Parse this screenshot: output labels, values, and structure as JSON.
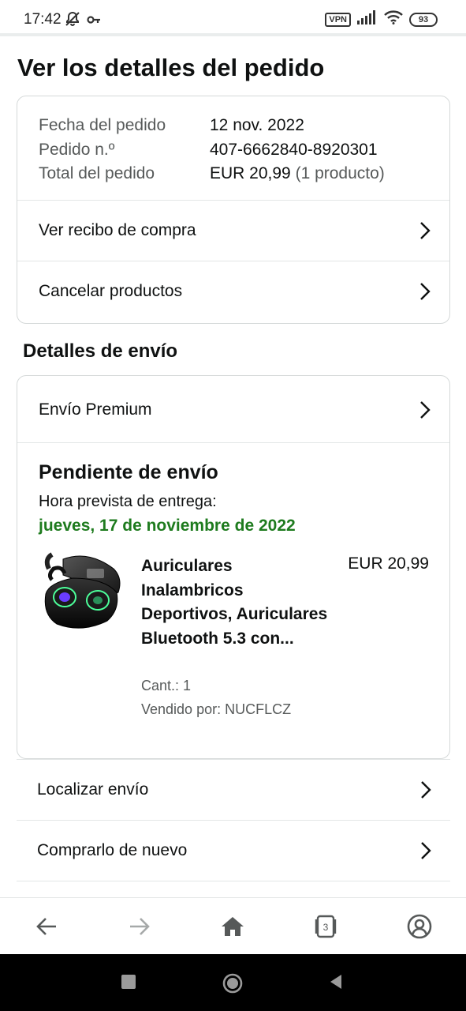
{
  "status_bar": {
    "time": "17:42",
    "vpn": "VPN",
    "battery": "93",
    "icons": [
      "bell-off-icon",
      "key-icon",
      "vpn-icon",
      "signal-icon",
      "wifi-icon",
      "battery-icon"
    ]
  },
  "page": {
    "title": "Ver los detalles del pedido"
  },
  "order_summary": {
    "date_label": "Fecha del pedido",
    "date_value": "12 nov. 2022",
    "number_label": "Pedido n.º",
    "number_value": "407-6662840-8920301",
    "total_label": "Total del pedido",
    "total_value": "EUR 20,99",
    "total_count": "(1 producto)"
  },
  "order_actions": [
    {
      "label": "Ver recibo de compra"
    },
    {
      "label": "Cancelar productos"
    }
  ],
  "shipping": {
    "section_title": "Detalles de envío",
    "method": "Envío Premium",
    "status": "Pendiente de envío",
    "eta_label": "Hora prevista de entrega:",
    "eta_date": "jueves, 17 de noviembre de 2022",
    "product": {
      "title": "Auriculares Inalambricos Deportivos, Auriculares Bluetooth 5.3 con...",
      "price": "EUR 20,99",
      "qty": "Cant.: 1",
      "seller": "Vendido por: NUCFLCZ"
    }
  },
  "more_actions": [
    {
      "label": "Localizar envío"
    },
    {
      "label": "Comprarlo de nuevo"
    }
  ],
  "toolbar": {
    "tabs_count": "3",
    "icons": [
      "back-arrow-icon",
      "forward-arrow-icon",
      "home-icon",
      "tabs-icon",
      "account-icon"
    ]
  },
  "colors": {
    "eta_green": "#1e7b1e",
    "text": "#0f1111",
    "muted": "#565959",
    "border": "#d5d9d9"
  }
}
